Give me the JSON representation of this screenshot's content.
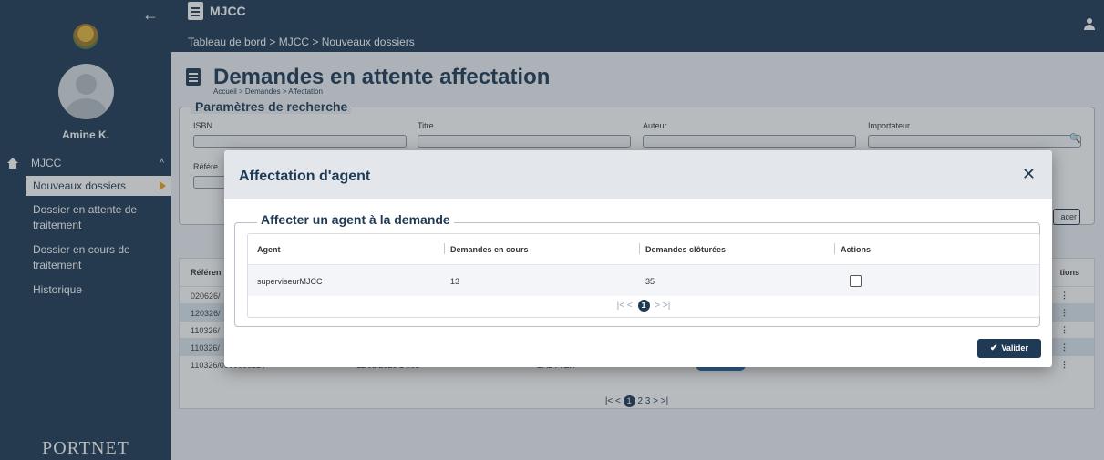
{
  "sidebar": {
    "username": "Amine K.",
    "section_label": "MJCC",
    "items": [
      {
        "label": "Nouveaux dossiers"
      },
      {
        "label": "Dossier en attente de traitement"
      },
      {
        "label": "Dossier en cours de traitement"
      },
      {
        "label": "Historique"
      }
    ],
    "brand": "PORTNET"
  },
  "header": {
    "title": "MJCC",
    "breadcrumb": "Tableau de bord > MJCC > Nouveaux dossiers"
  },
  "page": {
    "title": "Demandes en attente affectation",
    "breadcrumb": "Accueil > Demandes > Affectation",
    "search": {
      "legend": "Paramètres de recherche",
      "fields": [
        "ISBN",
        "Titre",
        "Auteur",
        "Importateur"
      ],
      "field2": "Référe",
      "reset_label": "acer"
    },
    "results": {
      "col_first": "Référen",
      "col_last": "tions",
      "rows": [
        {
          "ref": "020626/",
          "date": "",
          "name": "",
          "badge": ""
        },
        {
          "ref": "120326/",
          "date": "",
          "name": "",
          "badge": ""
        },
        {
          "ref": "110326/",
          "date": "",
          "name": "",
          "badge": ""
        },
        {
          "ref": "110326/",
          "date": "",
          "name": "",
          "badge": ""
        },
        {
          "ref": "110326/0000000214",
          "date": "11/03/2026 14:05",
          "name": "BABYTEX",
          "badge": "Dossier soumis"
        }
      ],
      "pager": {
        "pages": [
          "1",
          "2",
          "3"
        ],
        "current": "1"
      }
    }
  },
  "modal": {
    "title": "Affectation d'agent",
    "close_icon": "close-icon",
    "fieldset_legend": "Affecter un agent à la demande",
    "columns": [
      "Agent",
      "Demandes en cours",
      "Demandes clôturées",
      "Actions"
    ],
    "rows": [
      {
        "agent": "superviseurMJCC",
        "en_cours": "13",
        "cloturees": "35",
        "selected": false
      }
    ],
    "pager": {
      "current": "1"
    },
    "submit_label": "Valider"
  }
}
